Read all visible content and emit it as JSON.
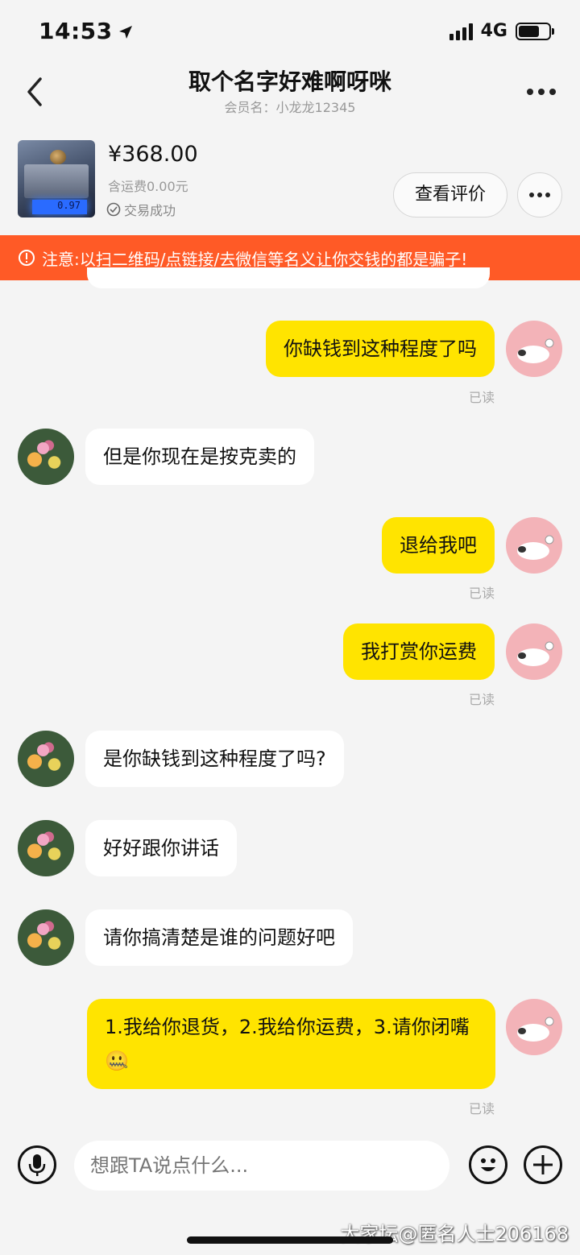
{
  "status_bar": {
    "time": "14:53",
    "network": "4G"
  },
  "nav": {
    "title": "取个名字好难啊呀咪",
    "subtitle": "会员名：小龙龙12345"
  },
  "product": {
    "price": "¥368.00",
    "shipping": "含运费0.00元",
    "status": "交易成功",
    "review_button": "查看评价",
    "scale_readout": "0.97"
  },
  "warning": {
    "text": "注意:以扫二维码/点链接/去微信等名义让你交钱的都是骗子!"
  },
  "messages": [
    {
      "from": "me",
      "text": "你缺钱到这种程度了吗",
      "read": "已读"
    },
    {
      "from": "other",
      "text": "但是你现在是按克卖的"
    },
    {
      "from": "me",
      "text": "退给我吧",
      "read": "已读"
    },
    {
      "from": "me",
      "text": "我打赏你运费",
      "read": "已读"
    },
    {
      "from": "other",
      "text": "是你缺钱到这种程度了吗?"
    },
    {
      "from": "other",
      "text": "好好跟你讲话"
    },
    {
      "from": "other",
      "text": "请你搞清楚是谁的问题好吧"
    },
    {
      "from": "me",
      "text": "1.我给你退货，2.我给你运费，3.请你闭嘴🤐",
      "read": "已读"
    }
  ],
  "input": {
    "placeholder": "想跟TA说点什么..."
  },
  "watermark": "大家坛@匿名人士206168"
}
